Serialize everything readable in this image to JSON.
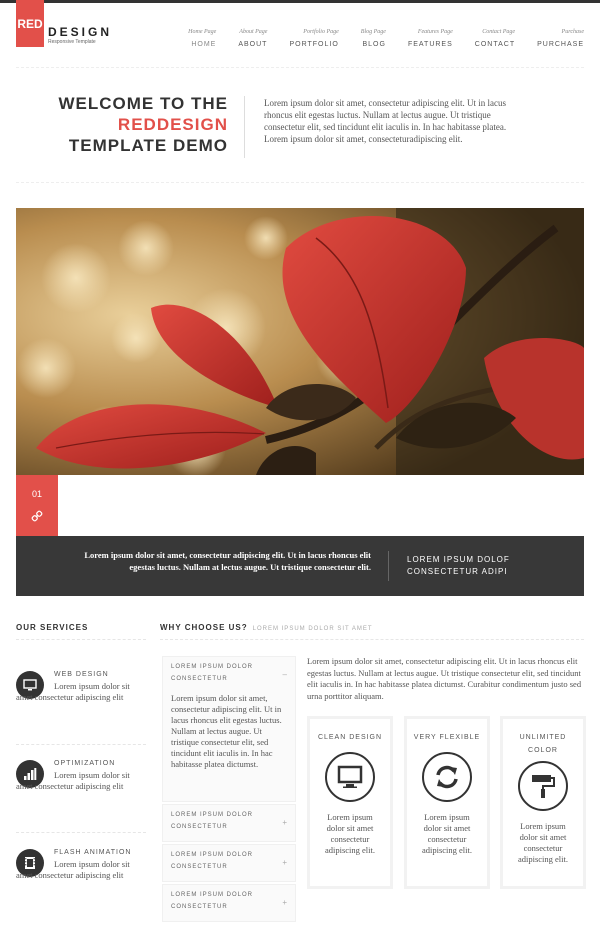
{
  "brand": {
    "logo_red": "RED",
    "logo_word": "DESIGN",
    "tagline": "Responsive Template"
  },
  "nav": [
    {
      "sub": "Home Page",
      "label": "HOME"
    },
    {
      "sub": "About Page",
      "label": "ABOUT"
    },
    {
      "sub": "Portfolio Page",
      "label": "PORTFOLIO"
    },
    {
      "sub": "Blog Page",
      "label": "BLOG"
    },
    {
      "sub": "Features Page",
      "label": "FEATURES"
    },
    {
      "sub": "Contact Page",
      "label": "CONTACT"
    },
    {
      "sub": "Purchase",
      "label": "PURCHASE"
    }
  ],
  "welcome": {
    "line1": "WELCOME TO THE",
    "line2": "REDDESIGN",
    "line3": "TEMPLATE DEMO",
    "text": "Lorem ipsum dolor sit amet, consectetur adipiscing elit. Ut in lacus rhoncus elit egestas luctus. Nullam at lectus augue. Ut tristique consectetur elit, sed tincidunt elit iaculis in. In hac habitasse platea. Lorem ipsum dolor sit amet, consecteturadipiscing elit."
  },
  "slider": {
    "number": "01",
    "icon": "link-icon",
    "caption": "Lorem ipsum dolor sit amet, consectetur adipiscing elit. Ut in lacus rhoncus elit egestas luctus. Nullam at lectus augue. Ut tristique consectetur elit.",
    "title_line1": "LOREM IPSUM DOLOF",
    "title_line2": "CONSECTETUR ADIPI"
  },
  "services": {
    "heading": "OUR SERVICES",
    "items": [
      {
        "title": "WEB DESIGN",
        "text": "Lorem ipsum dolor sit amet consectetur adipiscing elit",
        "icon": "monitor-icon"
      },
      {
        "title": "OPTIMIZATION",
        "text": "Lorem ipsum dolor sit amet consectetur adipiscing elit",
        "icon": "bar-chart-icon"
      },
      {
        "title": "FLASH ANIMATION",
        "text": "Lorem ipsum dolor sit amet consectetur adipiscing elit",
        "icon": "film-icon"
      }
    ]
  },
  "why": {
    "heading": "WHY CHOOSE US?",
    "subheading": "LOREM IPSUM DOLOR SIT AMET",
    "accordion": [
      {
        "title": "LOREM IPSUM DOLOR CONSECTETUR",
        "toggle": "–",
        "body": "Lorem ipsum dolor sit amet, consectetur adipiscing elit. Ut in lacus rhoncus elit egestas luctus. Nullam at lectus augue. Ut tristique consectetur elit, sed tincidunt elit iaculis in. In hac habitasse platea dictumst."
      },
      {
        "title": "LOREM IPSUM DOLOR CONSECTETUR",
        "toggle": "+"
      },
      {
        "title": "LOREM IPSUM DOLOR CONSECTETUR",
        "toggle": "+"
      },
      {
        "title": "LOREM IPSUM DOLOR CONSECTETUR",
        "toggle": "+"
      }
    ],
    "intro": "Lorem ipsum dolor sit amet, consectetur adipiscing elit. Ut in lacus rhoncus elit egestas luctus. Nullam at lectus augue. Ut tristique consectetur elit, sed tincidunt elit iaculis in. In hac habitasse platea dictumst. Curabitur condimentum justo sed urna porttitor aliquam.",
    "features": [
      {
        "title": "CLEAN DESIGN",
        "icon": "monitor-icon",
        "text": "Lorem ipsum dolor sit amet consectetur adipiscing elit."
      },
      {
        "title": "VERY FLEXIBLE",
        "icon": "refresh-icon",
        "text": "Lorem ipsum dolor sit amet consectetur adipiscing elit."
      },
      {
        "title": "UNLIMITED COLOR",
        "icon": "paint-roller-icon",
        "text": "Lorem ipsum dolor sit amet consectetur adipiscing elit."
      }
    ]
  },
  "colors": {
    "accent": "#e2504a",
    "dark": "#383838"
  }
}
